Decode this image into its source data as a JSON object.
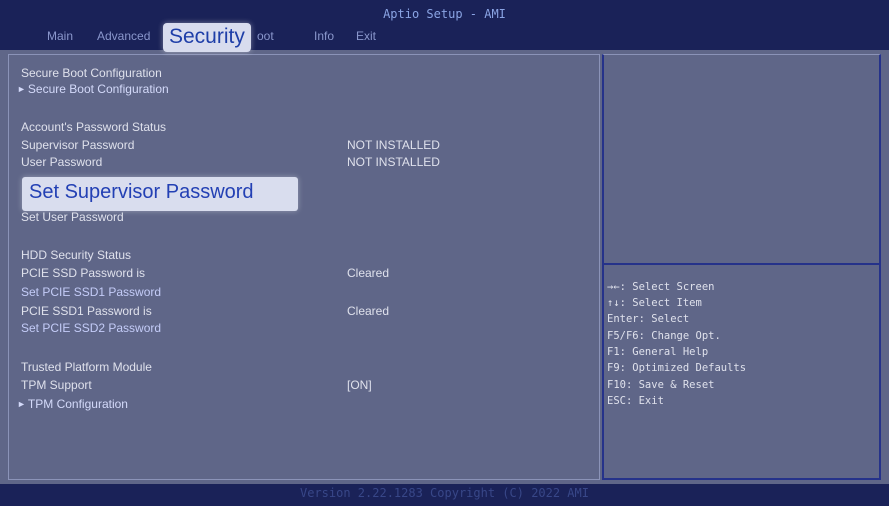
{
  "app_title": "Aptio Setup - AMI",
  "menu": {
    "items": [
      {
        "key": "main",
        "label": "Main"
      },
      {
        "key": "advanced",
        "label": "Advanced"
      },
      {
        "key": "security",
        "label": "Security"
      },
      {
        "key": "boot",
        "label": "oot"
      },
      {
        "key": "info",
        "label": "Info"
      },
      {
        "key": "exit",
        "label": "Exit"
      }
    ],
    "active": "Security"
  },
  "settings": {
    "secure_boot_header": "Secure Boot Configuration",
    "secure_boot_link": "Secure Boot Configuration",
    "password_status_header": "Account's Password Status",
    "supervisor_password_label": "Supervisor Password",
    "supervisor_password_value": "NOT INSTALLED",
    "user_password_label": "User Password",
    "user_password_value": "NOT INSTALLED",
    "set_supervisor_password": "Set Supervisor Password",
    "set_user_password": "Set User Password",
    "hdd_security_header": "HDD Security Status",
    "pcie_ssd_password_label": "PCIE SSD Password is",
    "pcie_ssd_password_value": "Cleared",
    "set_pcie_ssd1_password": "Set PCIE SSD1 Password",
    "pcie_ssd1_password_label": "PCIE SSD1 Password is",
    "pcie_ssd1_password_value": "Cleared",
    "set_pcie_ssd2_password": "Set PCIE SSD2 Password",
    "tpm_header": "Trusted Platform Module",
    "tpm_support_label": "TPM Support",
    "tpm_support_value": "[ON]",
    "tpm_configuration_link": "TPM Configuration"
  },
  "help": {
    "select_screen": "→←: Select Screen",
    "select_item": "↑↓: Select Item",
    "enter": "Enter: Select",
    "change_opt": "F5/F6: Change Opt.",
    "general_help": "F1: General Help",
    "optimized_defaults": "F9: Optimized Defaults",
    "save_reset": "F10: Save & Reset",
    "exit": "ESC: Exit"
  },
  "footer": "Version 2.22.1283 Copyright (C) 2022 AMI",
  "colors": {
    "header_bg": "#1a2258",
    "panel_bg": "#5f6688",
    "highlight_bg": "#d9ddee",
    "highlight_text": "#2340b4",
    "divider": "#25328a"
  }
}
